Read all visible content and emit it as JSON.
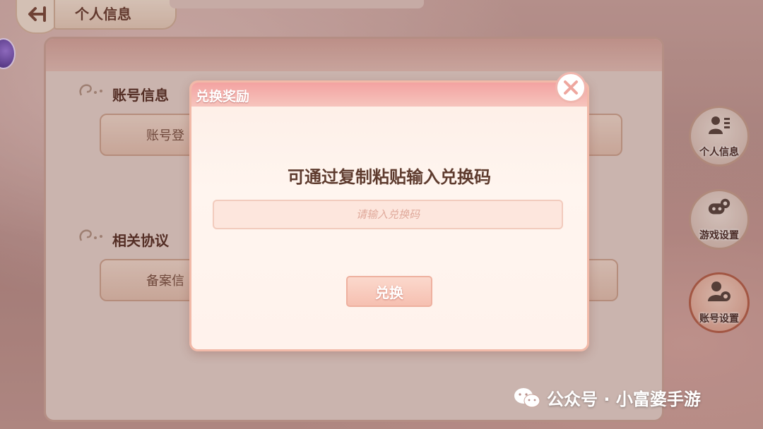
{
  "header": {
    "back_icon": "back-arrow-icon",
    "title": "个人信息"
  },
  "sections": [
    {
      "title": "账号信息",
      "button_label": "账号登"
    },
    {
      "title": "相关协议",
      "button_label": "备案信"
    }
  ],
  "side_nav": [
    {
      "label": "个人信息",
      "icon": "profile-card-icon",
      "active": false
    },
    {
      "label": "游戏设置",
      "icon": "gamepad-gear-icon",
      "active": false
    },
    {
      "label": "账号设置",
      "icon": "user-gear-icon",
      "active": true
    }
  ],
  "modal": {
    "title": "兑换奖励",
    "prompt": "可通过复制粘贴输入兑换码",
    "input_placeholder": "请输入兑换码",
    "input_value": "",
    "submit_label": "兑换",
    "close_icon": "close-icon"
  },
  "watermark": {
    "text": "公众号 · 小富婆手游",
    "icon": "wechat-icon"
  },
  "colors": {
    "modal_header": "#f3a2a1",
    "accent": "#f1b9a8",
    "text_brown": "#5e3b2e"
  }
}
